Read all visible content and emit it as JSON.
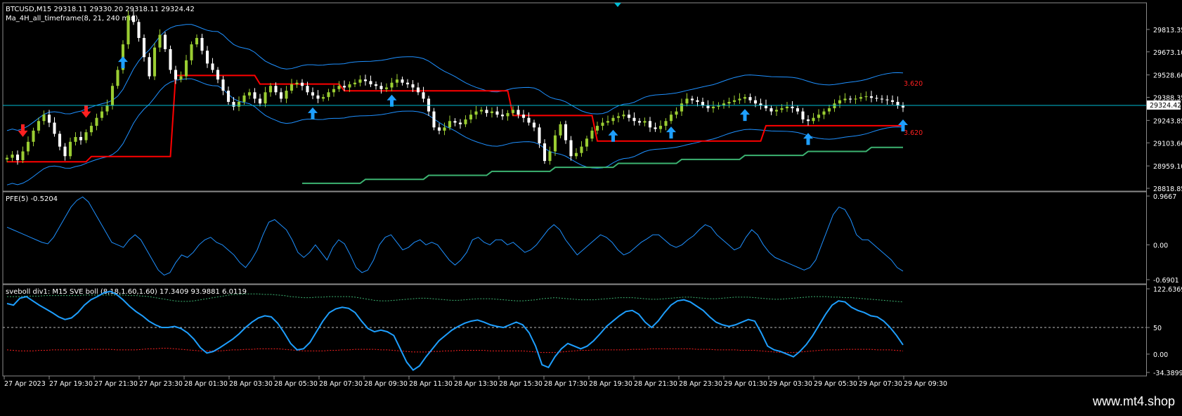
{
  "header": {
    "symbol_line": "BTCUSD,M15  29318.11 29330.20 29318.11 29324.42",
    "indicator_line": "Ma_4H_all_timeframe(8, 21, 240 min)"
  },
  "panes": {
    "pfe_title": "PFE(5) -0.5204",
    "sve_title": "sveboll div1: M15 SVE boll (8,18,1.60,1.60) 17.3409 93.9881 6.0119"
  },
  "watermark": "www.mt4.shop",
  "colors": {
    "background": "#000000",
    "bull_candle": "#9acd32",
    "bear_candle": "#ffffff",
    "band": "#1e90ff",
    "red_line": "#ff0000",
    "green_line": "#3cb371",
    "current_price_line": "#00bcd4",
    "up_arrow": "#1e9fff",
    "down_arrow": "#ff2020"
  },
  "chart_data": [
    {
      "type": "candlestick",
      "title": "BTCUSD,M15",
      "ylim": [
        28818.85,
        29953.6
      ],
      "y_ticks": [
        "29813.35",
        "29673.10",
        "29528.60",
        "29388.35",
        "29243.85",
        "29103.60",
        "28959.10",
        "28818.85"
      ],
      "current_price": "29324.42",
      "band_labels": {
        "upper": "3.620",
        "lower": "3.620"
      },
      "x_labels": [
        "27 Apr 2023",
        "27 Apr 19:30",
        "27 Apr 21:30",
        "27 Apr 23:30",
        "28 Apr 01:30",
        "28 Apr 03:30",
        "28 Apr 05:30",
        "28 Apr 07:30",
        "28 Apr 09:30",
        "28 Apr 11:30",
        "28 Apr 13:30",
        "28 Apr 15:30",
        "28 Apr 17:30",
        "28 Apr 19:30",
        "28 Apr 21:30",
        "28 Apr 23:30",
        "29 Apr 01:30",
        "29 Apr 03:30",
        "29 Apr 05:30",
        "29 Apr 07:30",
        "29 Apr 09:30"
      ],
      "close": [
        29010,
        29030,
        28995,
        29050,
        29110,
        29180,
        29240,
        29280,
        29230,
        29160,
        29080,
        29020,
        29110,
        29140,
        29120,
        29170,
        29210,
        29260,
        29300,
        29340,
        29460,
        29560,
        29720,
        29900,
        29860,
        29760,
        29640,
        29520,
        29700,
        29780,
        29690,
        29560,
        29500,
        29520,
        29620,
        29720,
        29760,
        29680,
        29600,
        29560,
        29500,
        29430,
        29360,
        29330,
        29360,
        29400,
        29420,
        29380,
        29350,
        29420,
        29460,
        29420,
        29380,
        29430,
        29470,
        29480,
        29460,
        29420,
        29400,
        29380,
        29390,
        29420,
        29440,
        29460,
        29450,
        29470,
        29480,
        29500,
        29490,
        29470,
        29460,
        29440,
        29450,
        29480,
        29500,
        29480,
        29470,
        29450,
        29420,
        29380,
        29300,
        29200,
        29180,
        29200,
        29240,
        29230,
        29220,
        29250,
        29280,
        29300,
        29310,
        29290,
        29300,
        29280,
        29270,
        29290,
        29310,
        29280,
        29260,
        29230,
        29200,
        29100,
        28990,
        29050,
        29150,
        29220,
        29120,
        29020,
        29040,
        29080,
        29130,
        29180,
        29210,
        29230,
        29240,
        29260,
        29270,
        29280,
        29260,
        29240,
        29230,
        29240,
        29200,
        29190,
        29210,
        29240,
        29280,
        29300,
        29350,
        29380,
        29370,
        29360,
        29340,
        29320,
        29330,
        29340,
        29350,
        29360,
        29370,
        29380,
        29390,
        29370,
        29350,
        29340,
        29320,
        29300,
        29310,
        29320,
        29330,
        29320,
        29300,
        29250,
        29240,
        29260,
        29280,
        29300,
        29320,
        29350,
        29370,
        29380,
        29375,
        29380,
        29390,
        29395,
        29385,
        29380,
        29375,
        29370,
        29360,
        29340,
        29324.42
      ],
      "upper_band_label": "3.620",
      "lower_band_label": "3.620"
    },
    {
      "type": "line",
      "title": "PFE(5) -0.5204",
      "ylim": [
        -0.6901,
        0.9667
      ],
      "y_ticks": [
        "0.9667",
        "0.00",
        "-0.6901"
      ],
      "series": [
        {
          "values": [
            0.35,
            0.3,
            0.25,
            0.2,
            0.15,
            0.1,
            0.05,
            0.02,
            0.15,
            0.35,
            0.55,
            0.75,
            0.88,
            0.95,
            0.85,
            0.65,
            0.45,
            0.25,
            0.05,
            0.0,
            -0.05,
            0.1,
            0.2,
            0.1,
            -0.1,
            -0.3,
            -0.5,
            -0.6,
            -0.55,
            -0.35,
            -0.2,
            -0.25,
            -0.15,
            0.0,
            0.1,
            0.15,
            0.05,
            0.0,
            -0.1,
            -0.2,
            -0.35,
            -0.45,
            -0.3,
            -0.1,
            0.2,
            0.45,
            0.5,
            0.4,
            0.3,
            0.1,
            -0.15,
            -0.25,
            -0.15,
            0.0,
            -0.15,
            -0.3,
            -0.05,
            0.1,
            0.02,
            -0.2,
            -0.45,
            -0.55,
            -0.5,
            -0.3,
            0.0,
            0.15,
            0.2,
            0.05,
            -0.1,
            -0.05,
            0.05,
            0.1,
            0.0,
            0.05,
            0.0,
            -0.15,
            -0.3,
            -0.4,
            -0.3,
            -0.15,
            0.1,
            0.15,
            0.05,
            0.0,
            0.1,
            0.1,
            0.0,
            0.05,
            -0.05,
            -0.15,
            -0.1,
            0.0,
            0.15,
            0.3,
            0.4,
            0.3,
            0.1,
            -0.05,
            -0.2,
            -0.1,
            0.0,
            0.1,
            0.2,
            0.15,
            0.05,
            -0.1,
            -0.2,
            -0.15,
            -0.05,
            0.05,
            0.12,
            0.2,
            0.2,
            0.1,
            0.0,
            -0.05,
            0.0,
            0.1,
            0.18,
            0.3,
            0.4,
            0.35,
            0.2,
            0.1,
            0.0,
            -0.1,
            -0.05,
            0.15,
            0.3,
            0.2,
            0.0,
            -0.15,
            -0.25,
            -0.3,
            -0.35,
            -0.4,
            -0.45,
            -0.5,
            -0.45,
            -0.3,
            0.0,
            0.3,
            0.6,
            0.75,
            0.7,
            0.5,
            0.2,
            0.1,
            0.1,
            0.0,
            -0.1,
            -0.2,
            -0.3,
            -0.45,
            -0.52
          ]
        }
      ]
    },
    {
      "type": "line",
      "title": "sveboll div1: M15 SVE boll (8,18,1.60,1.60) 17.3409 93.9881 6.0119",
      "ylim": [
        -34.3899,
        122.6369
      ],
      "y_ticks": [
        "122.6369",
        "50",
        "0.00",
        "-34.3899"
      ],
      "series": [
        {
          "name": "sveboll",
          "values": [
            95,
            92,
            105,
            108,
            100,
            92,
            85,
            78,
            70,
            65,
            68,
            78,
            92,
            102,
            108,
            115,
            118,
            112,
            102,
            90,
            80,
            72,
            62,
            55,
            50,
            50,
            52,
            48,
            40,
            28,
            12,
            2,
            5,
            12,
            20,
            28,
            38,
            50,
            60,
            68,
            72,
            70,
            58,
            40,
            20,
            8,
            10,
            22,
            42,
            62,
            78,
            85,
            88,
            86,
            78,
            62,
            48,
            42,
            45,
            42,
            35,
            10,
            -15,
            -30,
            -22,
            -5,
            10,
            25,
            35,
            45,
            52,
            58,
            62,
            64,
            60,
            55,
            52,
            50,
            55,
            60,
            55,
            40,
            15,
            -20,
            -25,
            -5,
            10,
            20,
            15,
            10,
            15,
            25,
            38,
            52,
            62,
            72,
            80,
            82,
            75,
            60,
            50,
            62,
            78,
            92,
            100,
            102,
            98,
            90,
            82,
            70,
            60,
            55,
            52,
            55,
            60,
            65,
            62,
            40,
            15,
            8,
            5,
            0,
            -5,
            5,
            18,
            35,
            55,
            75,
            92,
            100,
            98,
            88,
            82,
            78,
            72,
            70,
            62,
            50,
            35,
            17.34
          ]
        },
        {
          "name": "upper",
          "values": [
            108,
            108,
            108,
            109,
            109,
            109,
            110,
            110,
            110,
            110,
            110,
            110,
            111,
            111,
            111,
            111,
            111,
            111,
            111,
            110,
            110,
            109,
            108,
            106,
            104,
            102,
            100,
            99,
            99,
            100,
            102,
            104,
            106,
            108,
            110,
            112,
            112,
            113,
            113,
            113,
            112,
            112,
            111,
            110,
            108,
            107,
            106,
            106,
            107,
            107,
            108,
            108,
            108,
            108,
            107,
            105,
            103,
            101,
            100,
            100,
            101,
            102,
            103,
            104,
            105,
            105,
            104,
            103,
            102,
            101,
            101,
            102,
            103,
            104,
            104,
            104,
            103,
            102,
            101,
            100,
            100,
            101,
            102,
            104,
            105,
            106,
            105,
            104,
            103,
            102,
            102,
            102,
            103,
            104,
            105,
            106,
            106,
            106,
            105,
            104,
            103,
            103,
            104,
            105,
            106,
            107,
            107,
            106,
            105,
            104,
            104,
            105,
            106,
            107,
            107,
            107,
            106,
            105,
            104,
            103,
            103,
            104,
            105,
            106,
            107,
            108,
            108,
            108,
            107,
            107,
            106,
            106,
            105,
            104,
            103,
            102,
            101,
            100,
            99,
            98
          ]
        },
        {
          "name": "lower",
          "values": [
            8,
            7,
            6,
            6,
            6,
            7,
            7,
            8,
            8,
            8,
            8,
            8,
            9,
            9,
            9,
            9,
            9,
            8,
            8,
            8,
            8,
            9,
            10,
            10,
            11,
            11,
            10,
            9,
            8,
            7,
            6,
            6,
            6,
            6,
            7,
            8,
            8,
            9,
            9,
            10,
            10,
            10,
            10,
            9,
            8,
            7,
            6,
            6,
            6,
            6,
            7,
            7,
            8,
            8,
            9,
            9,
            9,
            9,
            8,
            8,
            7,
            6,
            5,
            4,
            4,
            4,
            5,
            5,
            6,
            6,
            7,
            7,
            7,
            7,
            7,
            6,
            6,
            6,
            6,
            6,
            6,
            5,
            4,
            3,
            3,
            3,
            4,
            5,
            6,
            7,
            7,
            8,
            8,
            8,
            8,
            8,
            8,
            9,
            9,
            9,
            10,
            10,
            10,
            10,
            10,
            10,
            10,
            9,
            9,
            9,
            8,
            8,
            8,
            8,
            7,
            7,
            7,
            6,
            5,
            4,
            3,
            3,
            3,
            4,
            5,
            6,
            7,
            8,
            8,
            8,
            9,
            9,
            9,
            9,
            9,
            8,
            8,
            8,
            7,
            6
          ]
        },
        {
          "name": "mid",
          "values": [
            50,
            50
          ]
        }
      ]
    }
  ]
}
